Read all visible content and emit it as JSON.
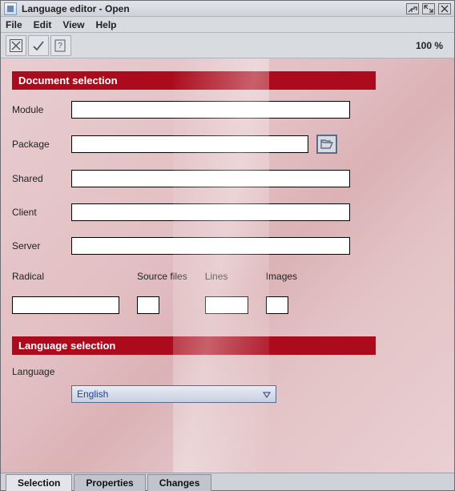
{
  "window": {
    "title": "Language editor - Open",
    "zoom": "100 %"
  },
  "menu": {
    "file": "File",
    "edit": "Edit",
    "view": "View",
    "help": "Help"
  },
  "sections": {
    "doc_sel": "Document selection",
    "lang_sel": "Language selection"
  },
  "fields": {
    "module": {
      "label": "Module",
      "value": ""
    },
    "package": {
      "label": "Package",
      "value": ""
    },
    "shared": {
      "label": "Shared",
      "value": ""
    },
    "client": {
      "label": "Client",
      "value": ""
    },
    "server": {
      "label": "Server",
      "value": ""
    },
    "radical": {
      "label": "Radical",
      "value": ""
    },
    "source_files": {
      "label": "Source files",
      "value": ""
    },
    "lines": {
      "label": "Lines",
      "value": ""
    },
    "images": {
      "label": "Images",
      "value": ""
    },
    "language": {
      "label": "Language",
      "value": "English"
    }
  },
  "tabs": {
    "selection": "Selection",
    "properties": "Properties",
    "changes": "Changes"
  }
}
